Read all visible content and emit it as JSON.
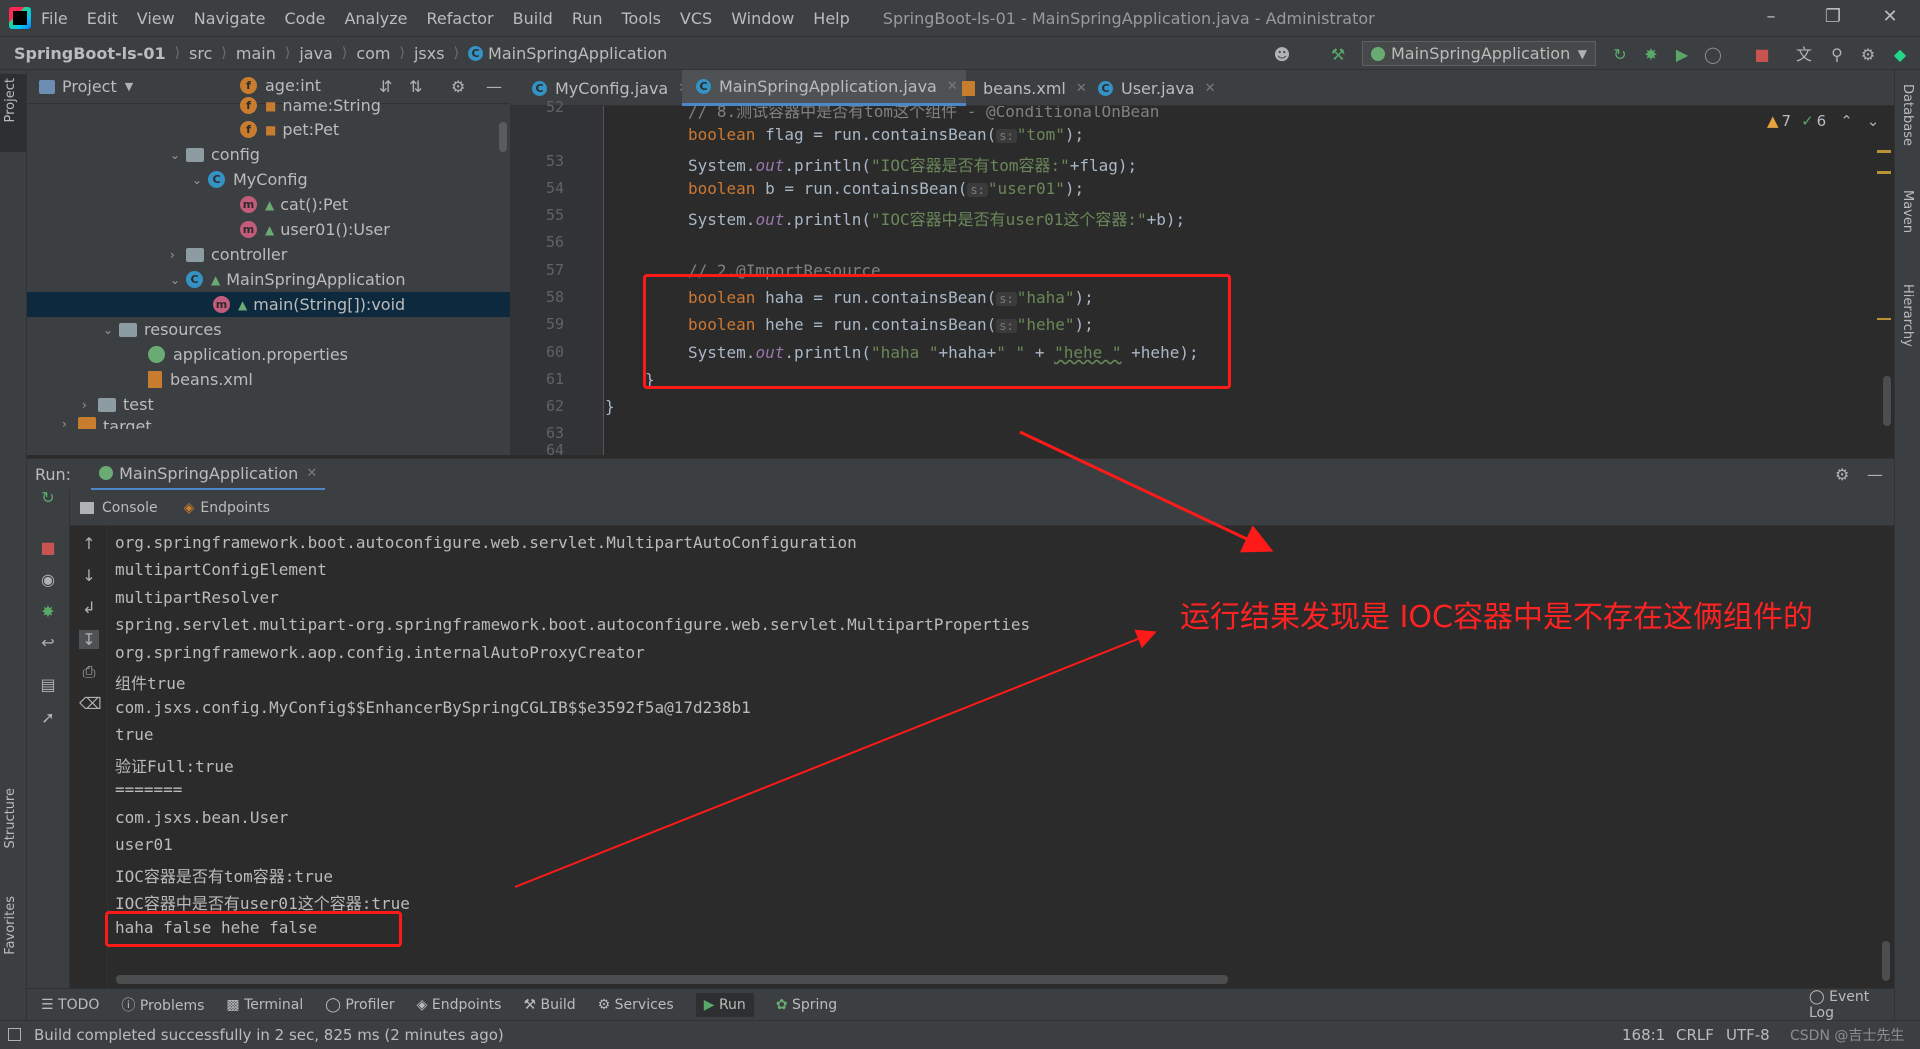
{
  "menu": {
    "items": [
      "File",
      "Edit",
      "View",
      "Navigate",
      "Code",
      "Analyze",
      "Refactor",
      "Build",
      "Run",
      "Tools",
      "VCS",
      "Window",
      "Help"
    ],
    "window_title": "SpringBoot-ls-01 - MainSpringApplication.java - Administrator"
  },
  "breadcrumb": [
    "SpringBoot-ls-01",
    "src",
    "main",
    "java",
    "com",
    "jsxs",
    "MainSpringApplication"
  ],
  "run_config": "MainSpringApplication",
  "project_panel": {
    "title": "Project",
    "tree": [
      {
        "label": "age:int",
        "icon": "field"
      },
      {
        "label": "name:String",
        "icon": "field"
      },
      {
        "label": "pet:Pet",
        "icon": "field"
      },
      {
        "label": "config",
        "icon": "folder"
      },
      {
        "label": "MyConfig",
        "icon": "class"
      },
      {
        "label": "cat():Pet",
        "icon": "method"
      },
      {
        "label": "user01():User",
        "icon": "method"
      },
      {
        "label": "controller",
        "icon": "folder"
      },
      {
        "label": "MainSpringApplication",
        "icon": "spring-class"
      },
      {
        "label": "main(String[]):void",
        "icon": "method"
      },
      {
        "label": "resources",
        "icon": "folder"
      },
      {
        "label": "application.properties",
        "icon": "properties"
      },
      {
        "label": "beans.xml",
        "icon": "xml"
      },
      {
        "label": "test",
        "icon": "folder"
      },
      {
        "label": "target",
        "icon": "folder"
      }
    ]
  },
  "editor": {
    "tabs": [
      "MyConfig.java",
      "MainSpringApplication.java",
      "beans.xml",
      "User.java"
    ],
    "active_tab": "MainSpringApplication.java",
    "warnings": "7",
    "checks": "6",
    "line_numbers": [
      "52",
      "53",
      "54",
      "55",
      "56",
      "57",
      "58",
      "59",
      "60",
      "61",
      "62",
      "63",
      "64"
    ],
    "code": {
      "l52": "// 8.测试容器中是否有tom这个组件 - @ConditionalOnBean",
      "l53_a": "boolean",
      "l53_b": " flag = run.containsBean(",
      "l53_h": "s:",
      "l53_s": "\"tom\"",
      "l53_c": ");",
      "l54_a": "System.",
      "l54_o": "out",
      "l54_b": ".println(",
      "l54_s": "\"IOC容器是否有tom容器:\"",
      "l54_c": "+flag);",
      "l55_a": "boolean",
      "l55_b": " b = run.containsBean(",
      "l55_h": "s:",
      "l55_s": "\"user01\"",
      "l55_c": ");",
      "l56_a": "System.",
      "l56_o": "out",
      "l56_b": ".println(",
      "l56_s": "\"IOC容器中是否有user01这个容器:\"",
      "l56_c": "+b);",
      "l58": "// 2.@ImportResource",
      "l59_a": "boolean",
      "l59_b": " haha = run.containsBean(",
      "l59_h": "s:",
      "l59_s": "\"haha\"",
      "l59_c": ");",
      "l60_a": "boolean",
      "l60_b": " hehe = run.containsBean(",
      "l60_h": "s:",
      "l60_s": "\"hehe\"",
      "l60_c": ");",
      "l61_a": "System.",
      "l61_o": "out",
      "l61_b": ".println(",
      "l61_s1": "\"haha \"",
      "l61_m": "+haha+",
      "l61_s2": "\" \"",
      "l61_p": " + ",
      "l61_s3": "\"hehe \"",
      "l61_c": " +hehe);",
      "l62": "}",
      "l63": "}"
    }
  },
  "run_panel": {
    "label": "Run:",
    "tab": "MainSpringApplication",
    "subtabs": [
      "Console",
      "Endpoints"
    ],
    "console_lines": [
      "org.springframework.boot.autoconfigure.web.servlet.MultipartAutoConfiguration",
      "multipartConfigElement",
      "multipartResolver",
      "spring.servlet.multipart-org.springframework.boot.autoconfigure.web.servlet.MultipartProperties",
      "org.springframework.aop.config.internalAutoProxyCreator",
      "组件true",
      "com.jsxs.config.MyConfig$$EnhancerBySpringCGLIB$$e3592f5a@17d238b1",
      "true",
      "验证Full:true",
      "=======",
      "com.jsxs.bean.User",
      "user01",
      "IOC容器是否有tom容器:true",
      "IOC容器中是否有user01这个容器:true",
      "haha false hehe false"
    ]
  },
  "annotation_note": "运行结果发现是 IOC容器中是不存在这俩组件的",
  "bottom_tabs": [
    "TODO",
    "Problems",
    "Terminal",
    "Profiler",
    "Endpoints",
    "Build",
    "Services",
    "Run",
    "Spring"
  ],
  "event_log": "Event Log",
  "status": {
    "message": "Build completed successfully in 2 sec, 825 ms (2 minutes ago)",
    "position": "168:1",
    "line_sep": "CRLF",
    "encoding": "UTF-8",
    "watermark": "CSDN @吉士先生"
  },
  "side_tabs": {
    "left": [
      "Project",
      "Structure",
      "Favorites"
    ],
    "right": [
      "Database",
      "Maven",
      "Hierarchy"
    ]
  },
  "colors": {
    "keyword": "#cc7832",
    "string": "#6a8759",
    "static_field": "#9876aa",
    "annotation_red": "#ff1a1a",
    "selection": "#0d293e",
    "active_tab_underline": "#4a88c7"
  }
}
